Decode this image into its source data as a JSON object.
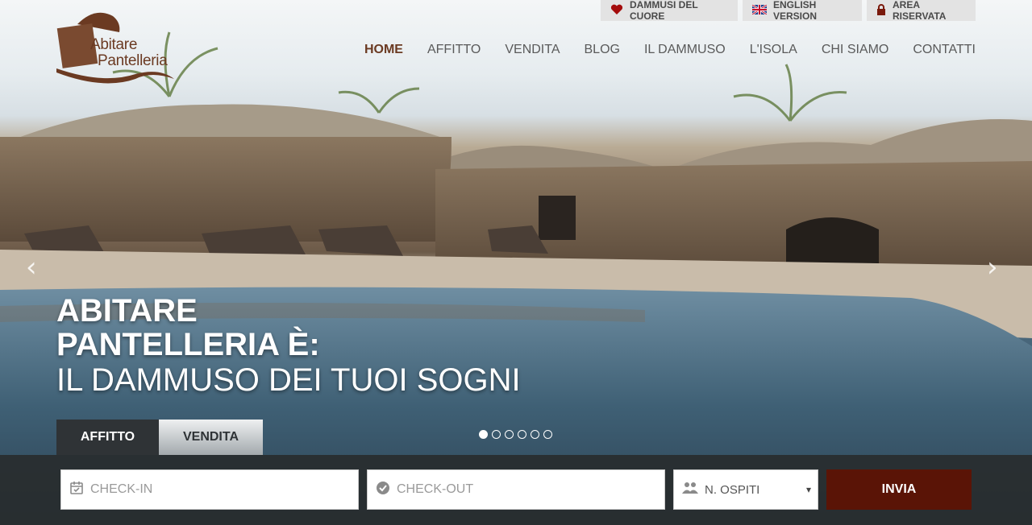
{
  "brand": {
    "line1": "Abitare",
    "line2": "Pantelleria"
  },
  "utility": {
    "favorites": "DAMMUSI DEL CUORE",
    "english": "ENGLISH VERSION",
    "reserved": "AREA RISERVATA"
  },
  "nav": {
    "items": [
      {
        "label": "HOME"
      },
      {
        "label": "AFFITTO"
      },
      {
        "label": "VENDITA"
      },
      {
        "label": "BLOG"
      },
      {
        "label": "IL DAMMUSO"
      },
      {
        "label": "L'ISOLA"
      },
      {
        "label": "CHI SIAMO"
      },
      {
        "label": "CONTATTI"
      }
    ],
    "active": "HOME"
  },
  "hero": {
    "line1": "ABITARE",
    "line2": "PANTELLERIA È:",
    "line3": "IL DAMMUSO DEI TUOI SOGNI",
    "slide_count": 6,
    "active_slide": 1
  },
  "search": {
    "tabs": [
      {
        "label": "AFFITTO"
      },
      {
        "label": "VENDITA"
      }
    ],
    "active_tab": "AFFITTO",
    "checkin_placeholder": "CHECK-IN",
    "checkout_placeholder": "CHECK-OUT",
    "guests_placeholder": "N. OSPITI",
    "submit_label": "INVIA"
  },
  "colors": {
    "brand_brown": "#6b3a22",
    "submit_bg": "#5a1406",
    "bar_bg": "#2c3032"
  }
}
